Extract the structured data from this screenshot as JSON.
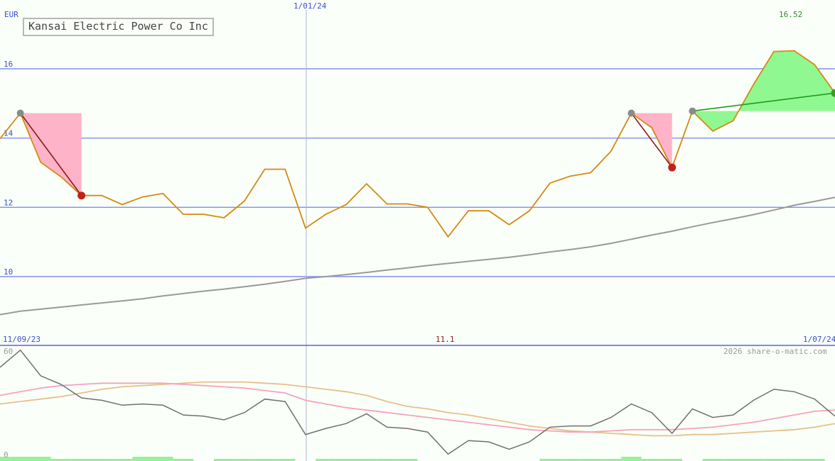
{
  "header": {
    "company": "Kansai Electric Power Co Inc",
    "currency": "EUR",
    "top_date": "1/01/24",
    "last_value_label": "16.52"
  },
  "footer": {
    "start_date": "11/09/23",
    "end_date": "1/07/24",
    "mid_value": "11.1",
    "watermark": "2026 share-o-matic.com",
    "osc_top": "60",
    "osc_bottom": "0"
  },
  "chart_data": {
    "type": "line",
    "x_range": [
      "11/09/23",
      "1/07/24"
    ],
    "y_ticks": [
      10,
      12,
      14,
      16
    ],
    "ylim": [
      8.5,
      17.7
    ],
    "series": [],
    "price": [
      13.98,
      14.72,
      13.3,
      12.88,
      12.34,
      12.34,
      12.08,
      12.3,
      12.4,
      11.8,
      11.8,
      11.7,
      12.18,
      13.1,
      13.1,
      11.4,
      11.8,
      12.08,
      12.68,
      12.1,
      12.1,
      12.0,
      11.15,
      11.9,
      11.9,
      11.5,
      11.9,
      12.7,
      12.9,
      13.0,
      13.62,
      14.72,
      14.3,
      13.15,
      14.78,
      14.2,
      14.5,
      15.55,
      16.5,
      16.52,
      16.12,
      15.3
    ],
    "ma_long": [
      8.9,
      9.0,
      9.06,
      9.12,
      9.18,
      9.24,
      9.3,
      9.36,
      9.44,
      9.51,
      9.58,
      9.64,
      9.71,
      9.78,
      9.86,
      9.95,
      10.0,
      10.06,
      10.12,
      10.19,
      10.25,
      10.32,
      10.38,
      10.44,
      10.5,
      10.56,
      10.63,
      10.71,
      10.78,
      10.86,
      10.96,
      11.08,
      11.2,
      11.31,
      11.44,
      11.56,
      11.67,
      11.79,
      11.92,
      12.06,
      12.17,
      12.29
    ],
    "oscillator": {
      "range": [
        0,
        60
      ],
      "main": [
        47,
        61,
        40,
        33,
        22,
        20,
        16,
        17,
        16,
        8,
        7,
        4,
        10,
        21,
        19,
        -8,
        -3,
        1,
        9,
        -2,
        -3,
        -6,
        -24,
        -13,
        -14,
        -20,
        -14,
        -2,
        -1,
        -1,
        6,
        17,
        10,
        -7,
        13,
        6,
        8,
        20,
        29,
        27,
        21,
        7
      ],
      "signal": [
        24,
        27,
        30,
        32,
        33,
        34,
        34,
        34,
        34,
        33,
        32,
        31,
        30,
        28,
        26,
        20,
        17,
        14,
        12,
        10,
        8,
        6,
        4,
        2,
        0,
        -2,
        -4,
        -5,
        -6,
        -6,
        -5,
        -4,
        -4,
        -4,
        -3,
        -2,
        0,
        2,
        5,
        8,
        11,
        12
      ],
      "slow": [
        17,
        19,
        21,
        23,
        26,
        29,
        31,
        32,
        33,
        34,
        35,
        35,
        35,
        34,
        33,
        31,
        29,
        27,
        24,
        19,
        15,
        13,
        10,
        8,
        5,
        2,
        -1,
        -3,
        -5,
        -6,
        -7,
        -8,
        -9,
        -9,
        -8,
        -8,
        -7,
        -6,
        -5,
        -4,
        -2,
        1
      ],
      "volume": [
        2,
        2,
        2,
        1,
        1,
        1,
        1,
        2,
        2,
        1,
        0,
        1,
        1,
        1,
        1,
        0,
        1,
        1,
        1,
        1,
        1,
        0,
        0,
        0,
        0,
        0,
        0,
        1,
        1,
        1,
        1,
        2,
        1,
        1,
        0,
        1,
        1,
        1,
        1,
        1,
        1,
        0
      ]
    },
    "signals": [
      {
        "type": "loss",
        "from_index": 1,
        "to_index": 4,
        "from": 14.72,
        "to": 12.34
      },
      {
        "type": "loss",
        "from_index": 31,
        "to_index": 33,
        "from": 14.72,
        "to": 13.15
      },
      {
        "type": "gain",
        "from_index": 34,
        "to_index": 41,
        "from": 14.78,
        "to": 15.3
      }
    ],
    "colors": {
      "price": "#d38a12",
      "ma_long": "#9a9a9a",
      "grid": "#7f8ff0",
      "loss_fill": "#ffb3c8",
      "gain_fill": "#90f890",
      "loss_line": "#8b1a1a",
      "gain_line": "#1f9a1f",
      "osc_main": "#707070",
      "osc_signal": "#f4a3c0",
      "osc_slow": "#e6c08a",
      "volume": "#98f098"
    }
  }
}
